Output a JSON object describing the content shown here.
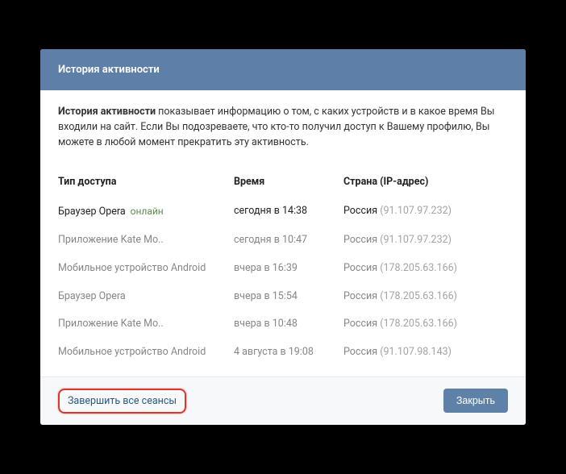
{
  "header": {
    "title": "История активности"
  },
  "body": {
    "desc_bold": "История активности",
    "desc_rest": " показывает информацию о том, с каких устройств и в какое время Вы входили на сайт. Если Вы подозреваете, что кто-то получил доступ к Вашему профилю, Вы можете в любой момент прекратить эту активность."
  },
  "table": {
    "headers": {
      "type": "Тип доступа",
      "time": "Время",
      "country": "Страна (IP-адрес)"
    },
    "sessions": [
      {
        "type": "Браузер Opera",
        "online": "онлайн",
        "time": "сегодня в 14:38",
        "country": "Россия",
        "ip": "(91.107.97.232)",
        "current": true
      },
      {
        "type": "Приложение Kate Mo..",
        "online": "",
        "time": "сегодня в 10:47",
        "country": "Россия",
        "ip": "(91.107.97.232)",
        "current": false
      },
      {
        "type": "Мобильное устройство Android",
        "online": "",
        "time": "вчера в 16:39",
        "country": "Россия",
        "ip": "(178.205.63.166)",
        "current": false
      },
      {
        "type": "Браузер Opera",
        "online": "",
        "time": "вчера в 15:54",
        "country": "Россия",
        "ip": "(178.205.63.166)",
        "current": false
      },
      {
        "type": "Приложение Kate Mo..",
        "online": "",
        "time": "вчера в 10:48",
        "country": "Россия",
        "ip": "(178.205.63.166)",
        "current": false
      },
      {
        "type": "Мобильное устройство Android",
        "online": "",
        "time": "4 августа в 19:08",
        "country": "Россия",
        "ip": "(91.107.98.143)",
        "current": false
      }
    ]
  },
  "footer": {
    "end_all": "Завершить все сеансы",
    "close": "Закрыть"
  }
}
